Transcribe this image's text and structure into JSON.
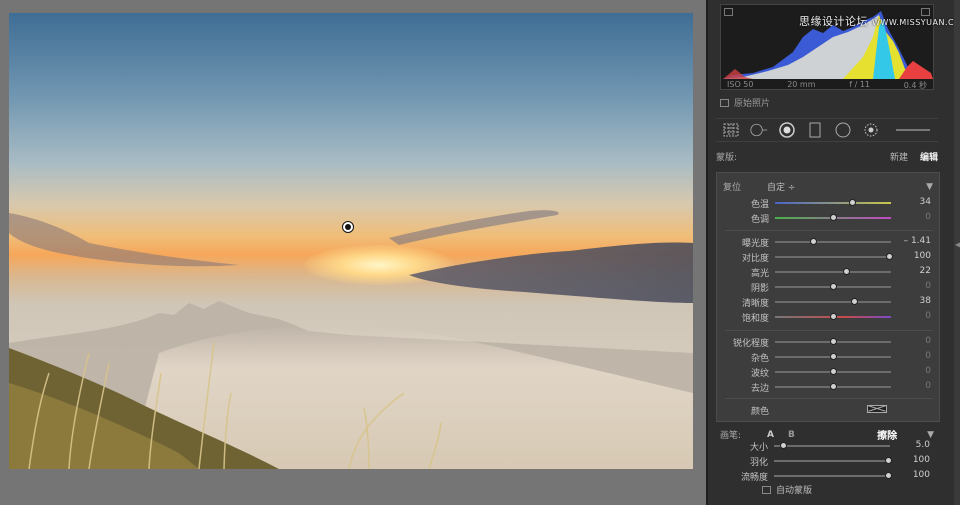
{
  "histogram": {
    "watermark": "思缘设计论坛",
    "watermark_url": "WWW.MISSYUAN.COM",
    "iso": "ISO 50",
    "focal": "20 mm",
    "aperture": "f / 11",
    "shutter": "0.4 秒",
    "original_photo_label": "原始照片"
  },
  "mask": {
    "label": "蒙版:",
    "new": "新建",
    "edit": "编辑"
  },
  "adjust": {
    "reset": "复位",
    "preset": "自定 ÷",
    "groups": [
      [
        {
          "label": "色温",
          "value": "34",
          "pos": 0.66
        },
        {
          "label": "色调",
          "value": "0",
          "pos": 0.5
        }
      ],
      [
        {
          "label": "曝光度",
          "value": "– 1.41",
          "pos": 0.33
        },
        {
          "label": "对比度",
          "value": "100",
          "pos": 0.98
        },
        {
          "label": "高光",
          "value": "22",
          "pos": 0.61
        },
        {
          "label": "阴影",
          "value": "0",
          "pos": 0.5
        },
        {
          "label": "清晰度",
          "value": "38",
          "pos": 0.68
        },
        {
          "label": "饱和度",
          "value": "0",
          "pos": 0.5
        }
      ],
      [
        {
          "label": "锐化程度",
          "value": "0",
          "pos": 0.5
        },
        {
          "label": "杂色",
          "value": "0",
          "pos": 0.5
        },
        {
          "label": "波纹",
          "value": "0",
          "pos": 0.5
        },
        {
          "label": "去边",
          "value": "0",
          "pos": 0.5
        }
      ]
    ],
    "color_label": "颜色"
  },
  "brush": {
    "label": "画笔:",
    "a": "A",
    "b": "B",
    "erase": "擦除",
    "sliders": [
      {
        "label": "大小",
        "value": "5.0",
        "pos": 0.08
      },
      {
        "label": "羽化",
        "value": "100",
        "pos": 0.98
      },
      {
        "label": "流畅度",
        "value": "100",
        "pos": 0.98
      }
    ],
    "automask": "自动蒙版"
  },
  "colors": {
    "panel": "#2f2f2f",
    "canvas": "#757575",
    "accent_white": "#eeeeee"
  }
}
